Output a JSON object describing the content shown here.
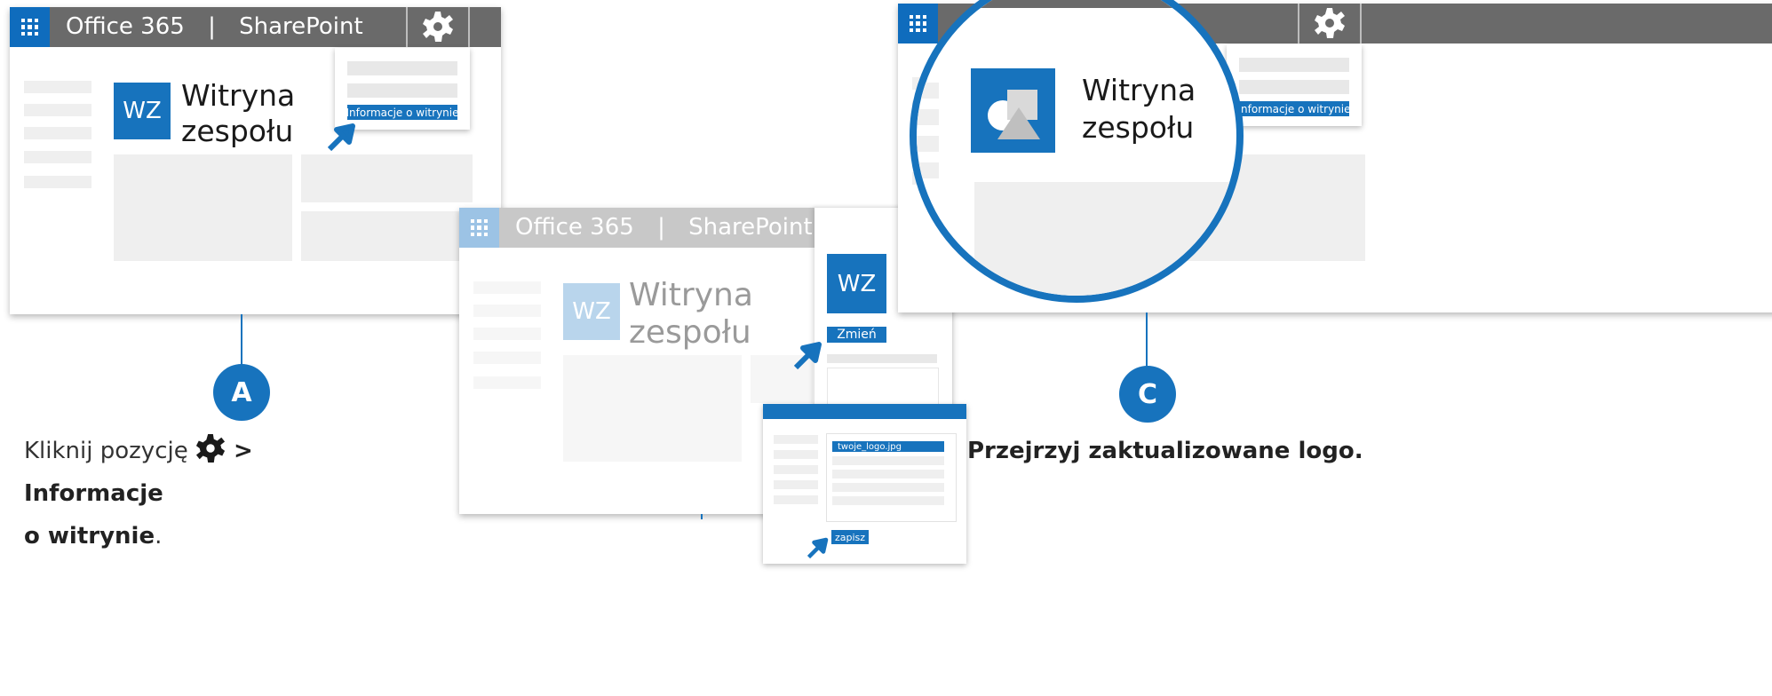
{
  "topbar": {
    "waffle_icon": "app-launcher-icon",
    "app_name": "Office 365",
    "separator": "|",
    "service_name": "SharePoint",
    "settings_icon": "gear-icon"
  },
  "site": {
    "logo_initials": "WZ",
    "title_line1": "Witryna",
    "title_line2": "zespołu"
  },
  "settings_menu": {
    "site_info_label": "Informacje o witrynie"
  },
  "site_info_panel": {
    "change_label": "Zmień"
  },
  "file_dialog": {
    "selected_file": "twoje_logo.jpg",
    "save_label": "zapisz"
  },
  "steps": [
    {
      "marker": "A",
      "text_before": "Kliknij pozycję ",
      "text_sep": " > ",
      "text_bold_1": "Informacje",
      "text_bold_2": "o witrynie",
      "text_after": "."
    },
    {
      "marker": "C",
      "text_bold": "Przejrzyj zaktualizowane logo."
    }
  ],
  "colors": {
    "accent": "#1773bd",
    "suite_bar": "#6a6a6a",
    "placeholder": "#efefef"
  }
}
